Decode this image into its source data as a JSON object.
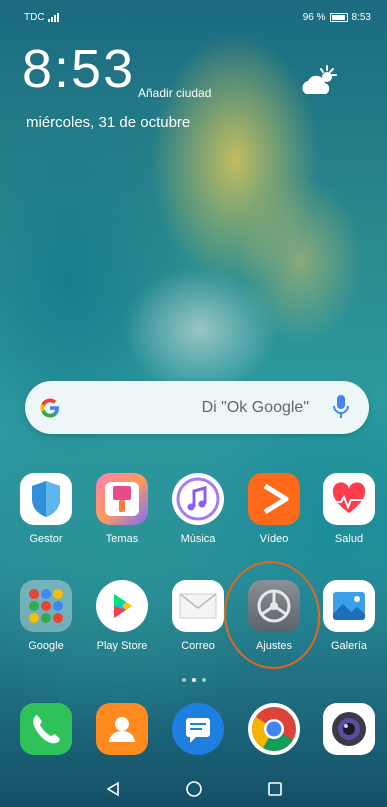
{
  "status_bar": {
    "carrier": "TDC",
    "battery": "96 %",
    "time": "8:53"
  },
  "lockscreen": {
    "clock": "8:53",
    "add_city": "Añadir ciudad",
    "date": "miércoles, 31 de octubre",
    "weather_icon": "partly-cloudy-icon"
  },
  "search": {
    "placeholder": "Di \"Ok Google\""
  },
  "apps_row1": [
    {
      "label": "Gestor",
      "icon": "shield-icon"
    },
    {
      "label": "Temas",
      "icon": "brush-icon"
    },
    {
      "label": "Música",
      "icon": "music-note-icon"
    },
    {
      "label": "Vídeo",
      "icon": "play-icon"
    },
    {
      "label": "Salud",
      "icon": "heart-icon"
    }
  ],
  "apps_row2": [
    {
      "label": "Google",
      "icon": "folder-icon"
    },
    {
      "label": "Play Store",
      "icon": "play-store-icon"
    },
    {
      "label": "Correo",
      "icon": "envelope-icon"
    },
    {
      "label": "Ajustes",
      "icon": "gear-icon"
    },
    {
      "label": "Galería",
      "icon": "gallery-icon"
    }
  ],
  "dock": [
    {
      "icon": "phone-icon"
    },
    {
      "icon": "contacts-icon"
    },
    {
      "icon": "messages-icon"
    },
    {
      "icon": "chrome-icon"
    },
    {
      "icon": "camera-icon"
    }
  ],
  "page_indicator": {
    "pages": 3,
    "active": 2
  },
  "colors": {
    "annotation": "#e5661e",
    "wallpaper": "#2a8a8e"
  }
}
